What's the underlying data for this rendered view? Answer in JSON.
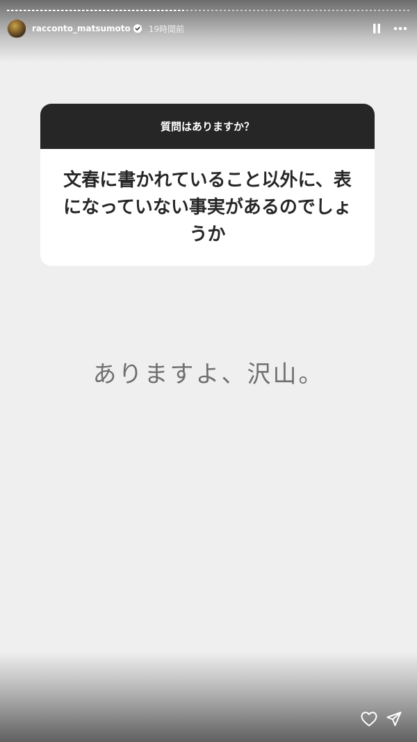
{
  "story": {
    "progress": 0.44
  },
  "header": {
    "username": "racconto_matsumoto",
    "timestamp": "19時間前"
  },
  "question_card": {
    "prompt": "質問はありますか？",
    "question": "文春に書かれていること以外に、表になっていない事実があるのでしょうか"
  },
  "answer_text": "ありますよ、沢山。",
  "colors": {
    "card_header_bg": "#262626",
    "background": "#efefef",
    "answer_text": "#6f6f6f"
  },
  "icons": {
    "verified": "verified-badge-icon",
    "pause": "pause-icon",
    "more": "more-horizontal-icon",
    "like": "heart-icon",
    "share": "send-icon"
  }
}
